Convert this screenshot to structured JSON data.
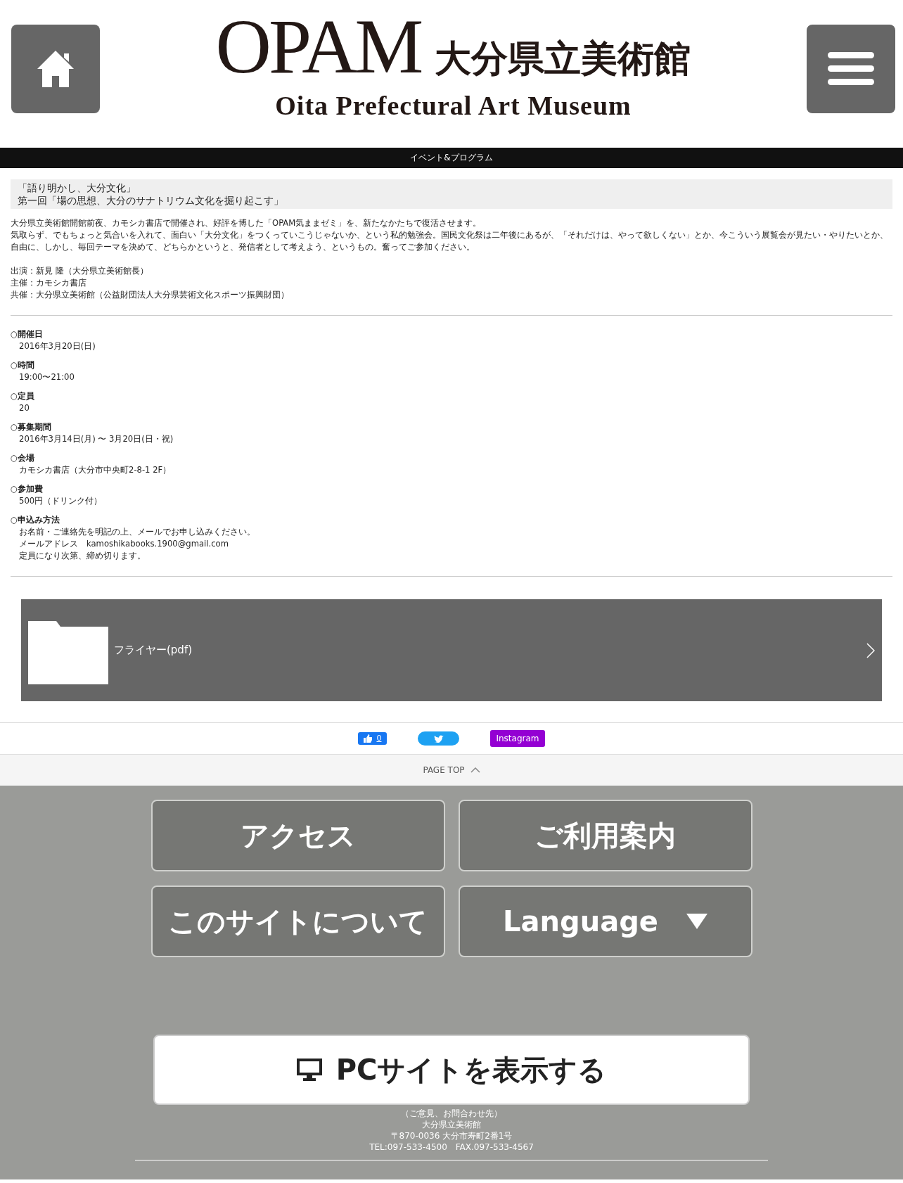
{
  "header": {
    "logo": {
      "mark": "OPAM",
      "name_ja": "大分県立美術館",
      "name_en": "Oita Prefectural Art Museum"
    }
  },
  "category_bar": "イベント&プログラム",
  "event": {
    "title_lines": [
      "「語り明かし、大分文化」",
      "第一回「場の思想、大分のサナトリウム文化を掘り起こす」"
    ],
    "description": [
      "大分県立美術館開館前夜、カモシカ書店で開催され、好評を博した「OPAM気ままゼミ」を、新たなかたちで復活させます。",
      "気取らず、でもちょっと気合いを入れて、面白い「大分文化」をつくっていこうじゃないか、という私的勉強会。国民文化祭は二年後にあるが、「それだけは、やって欲しくない」とか、今こういう展覧会が見たい・やりたいとか、",
      "自由に、しかし、毎回テーマを決めて、どちらかというと、発信者として考えよう、というもの。奮ってご参加ください。"
    ],
    "credits": [
      "出演：新見 隆（大分県立美術館長）",
      "主催：カモシカ書店",
      "共催：大分県立美術館（公益財団法人大分県芸術文化スポーツ振興財団）"
    ],
    "details": [
      {
        "label": "○開催日",
        "lines": [
          "2016年3月20日(日)"
        ]
      },
      {
        "label": "○時間",
        "lines": [
          "19:00〜21:00"
        ]
      },
      {
        "label": "○定員",
        "lines": [
          "20"
        ]
      },
      {
        "label": "○募集期間",
        "lines": [
          "2016年3月14日(月) 〜 3月20日(日・祝)"
        ]
      },
      {
        "label": "○会場",
        "lines": [
          "カモシカ書店（大分市中央町2-8-1 2F）"
        ]
      },
      {
        "label": "○参加費",
        "lines": [
          "500円（ドリンク付）"
        ]
      },
      {
        "label": "○申込み方法",
        "lines": [
          "お名前・ご連絡先を明記の上、メールでお申し込みください。",
          "メールアドレス　kamoshikabooks.1900@gmail.com",
          "定員になり次第、締め切ります。"
        ]
      }
    ],
    "attachment": {
      "label": "フライヤー(pdf)"
    }
  },
  "social": {
    "like_count": "0",
    "instagram": "Instagram"
  },
  "page_top": "PAGE TOP",
  "footer": {
    "nav": [
      {
        "kind": "link",
        "label": "アクセス"
      },
      {
        "kind": "link",
        "label": "ご利用案内"
      },
      {
        "kind": "link",
        "label": "このサイトについて"
      },
      {
        "kind": "dropdown",
        "label": "Language"
      }
    ],
    "pc_site": "PCサイトを表示する",
    "contact": [
      "（ご意見、お問合わせ先）",
      "大分県立美術館",
      "〒870-0036 大分市寿町2番1号",
      "TEL:097-533-4500　FAX.097-533-4567"
    ]
  }
}
